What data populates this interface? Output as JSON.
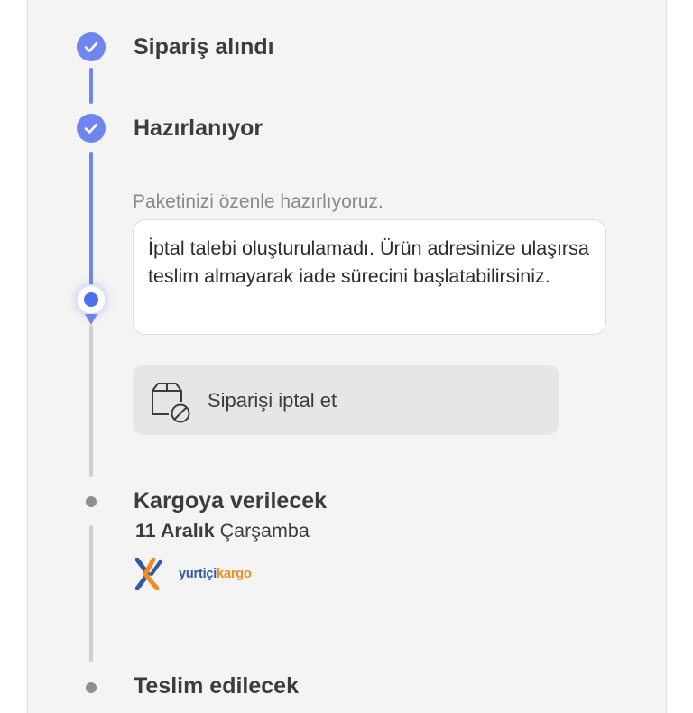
{
  "steps": {
    "received": {
      "title": "Sipariş alındı",
      "status": "done"
    },
    "preparing": {
      "title": "Hazırlanıyor",
      "status": "done",
      "subtitle": "Paketinizi özenle hazırlıyoruz.",
      "message": "İptal talebi oluşturulamadı. Ürün adresinize ulaşırsa teslim almayarak iade sürecini başlatabilirsiniz.",
      "cancel_label": "Siparişi iptal et"
    },
    "shipping": {
      "title": "Kargoya verilecek",
      "date_bold": "11 Aralık",
      "date_day": "Çarşamba",
      "carrier_logo_part1": "yurtiçi",
      "carrier_logo_part2": "kargo"
    },
    "delivery": {
      "title": "Teslim edilecek"
    }
  },
  "colors": {
    "accent": "#6f86f0",
    "accent_dark": "#4b6ef0",
    "carrier_blue": "#2f5aa8",
    "carrier_orange": "#f58a1f"
  },
  "icons": [
    "check-icon",
    "package-cancel-icon",
    "yurtici-kargo-logo"
  ]
}
